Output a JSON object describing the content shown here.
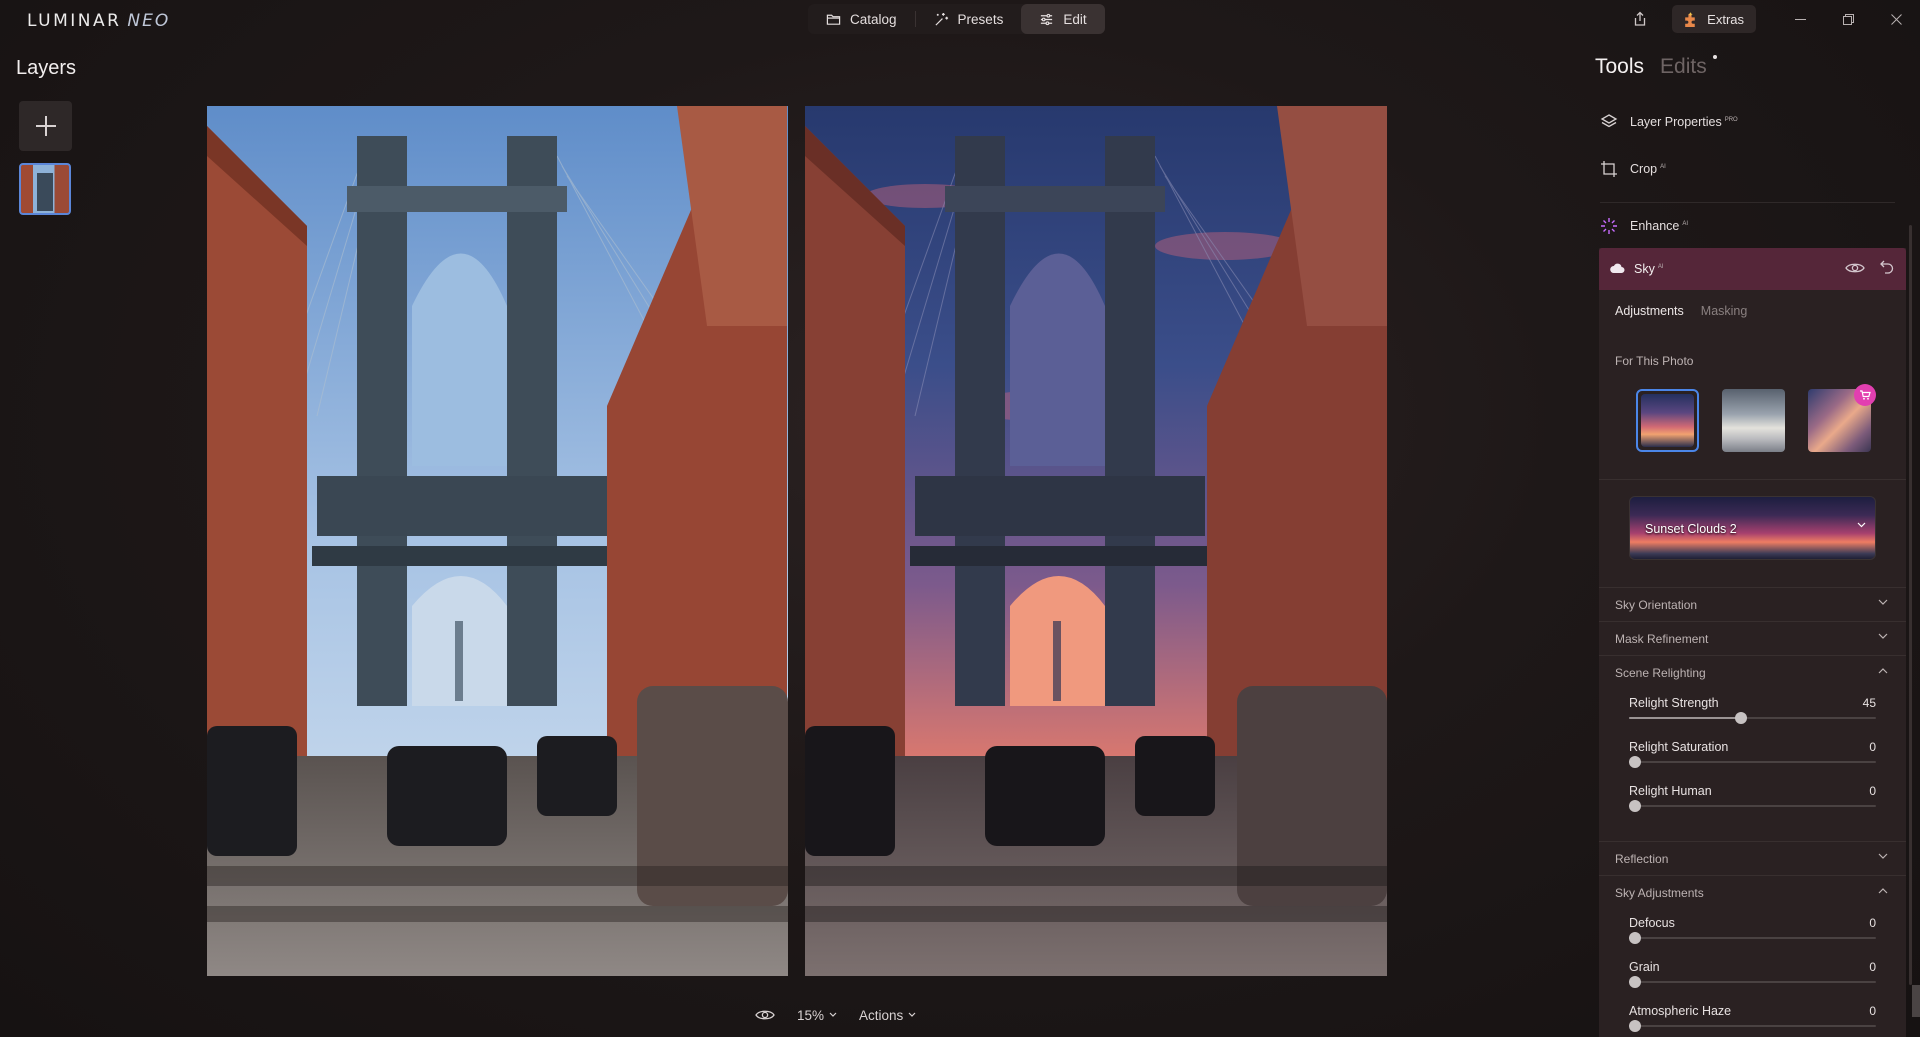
{
  "app": {
    "logo_main": "LUMINAR",
    "logo_sub": "NEO"
  },
  "modes": [
    {
      "label": "Catalog",
      "icon": "folder-icon",
      "active": false
    },
    {
      "label": "Presets",
      "icon": "presets-sparkle-icon",
      "active": false
    },
    {
      "label": "Edit",
      "icon": "sliders-icon",
      "active": true
    }
  ],
  "topbar": {
    "extras_label": "Extras"
  },
  "layers": {
    "title": "Layers"
  },
  "bottombar": {
    "zoom": "15%",
    "actions_label": "Actions"
  },
  "tools": {
    "tab_tools": "Tools",
    "tab_edits": "Edits",
    "items": [
      {
        "label": "Layer Properties",
        "badge": "PRO"
      },
      {
        "label": "Crop",
        "badge": "AI"
      },
      {
        "label": "Enhance",
        "badge": "AI"
      }
    ]
  },
  "sky": {
    "title": "Sky",
    "badge": "AI",
    "tabs": {
      "adjustments": "Adjustments",
      "masking": "Masking"
    },
    "for_this_photo": "For This Photo",
    "selected_sky": "Sunset Clouds 2",
    "sections": {
      "sky_orientation": "Sky Orientation",
      "mask_refinement": "Mask Refinement",
      "scene_relighting": "Scene Relighting",
      "reflection": "Reflection",
      "sky_adjustments": "Sky Adjustments"
    },
    "relight_sliders": [
      {
        "name": "Relight Strength",
        "value": "45",
        "fraction": 0.45
      },
      {
        "name": "Relight Saturation",
        "value": "0",
        "fraction": 0
      },
      {
        "name": "Relight Human",
        "value": "0",
        "fraction": 0
      }
    ],
    "sky_sliders": [
      {
        "name": "Defocus",
        "value": "0",
        "fraction": 0
      },
      {
        "name": "Grain",
        "value": "0",
        "fraction": 0
      },
      {
        "name": "Atmospheric Haze",
        "value": "0",
        "fraction": 0
      }
    ]
  },
  "colors": {
    "accent_blue": "#4b86e8",
    "sky_header": "#552639",
    "cart_badge": "#e23fb0"
  }
}
